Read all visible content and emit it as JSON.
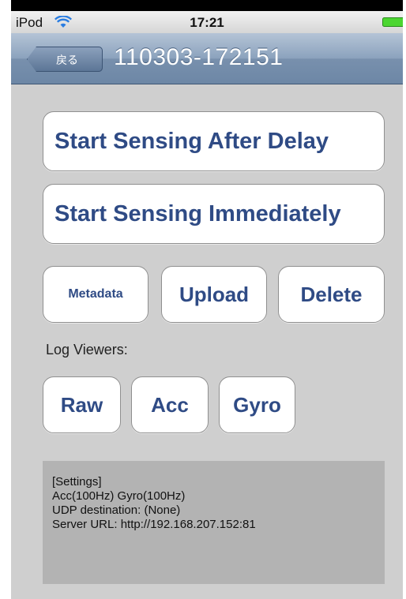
{
  "status_bar": {
    "carrier": "iPod",
    "time": "17:21"
  },
  "nav": {
    "back_label": "戻る",
    "title": "110303-172151"
  },
  "buttons": {
    "start_after_delay": "Start Sensing After Delay",
    "start_immediately": "Start Sensing Immediately",
    "metadata": "Metadata",
    "upload": "Upload",
    "delete": "Delete"
  },
  "log_viewers": {
    "label": "Log Viewers:",
    "raw": "Raw",
    "acc": "Acc",
    "gyro": "Gyro"
  },
  "settings": {
    "lines": [
      "[Settings]",
      "Acc(100Hz) Gyro(100Hz)",
      "UDP destination: (None)",
      "Server URL: http://192.168.207.152:81"
    ]
  },
  "colors": {
    "button_text": "#2f4b85",
    "nav_bar": "#8ba2bd",
    "background": "#cfcfcf",
    "battery": "#4cd631"
  }
}
